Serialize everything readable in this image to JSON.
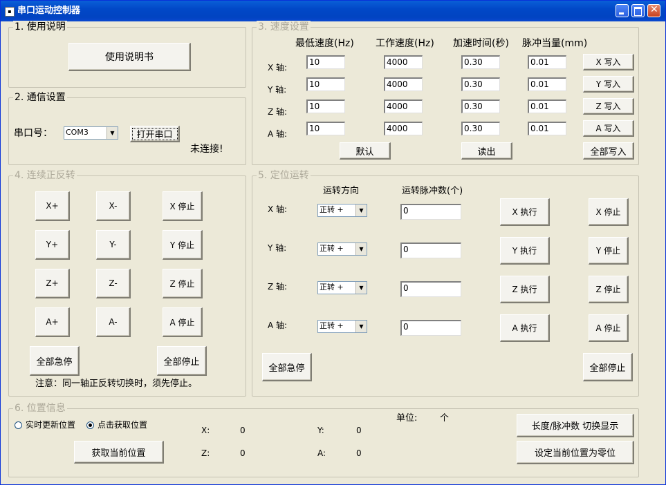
{
  "window": {
    "title": "串口运动控制器",
    "app_icon": "app-icon"
  },
  "usage": {
    "group": "1. 使用说明",
    "manual_button": "使用说明书"
  },
  "comm": {
    "group": "2. 通信设置",
    "port_label": "串口号：",
    "port_value": "COM3",
    "open_button": "打开串口",
    "status": "未连接!"
  },
  "speed": {
    "group": "3. 速度设置",
    "headers": {
      "min_speed": "最低速度(Hz)",
      "work_speed": "工作速度(Hz)",
      "accel_time": "加速时间(秒)",
      "pulse_eq": "脉冲当量(mm)"
    },
    "rows": [
      {
        "axis": "X 轴:",
        "min": "10",
        "work": "4000",
        "accel": "0.30",
        "pulse": "0.01",
        "write": "X 写入"
      },
      {
        "axis": "Y 轴:",
        "min": "10",
        "work": "4000",
        "accel": "0.30",
        "pulse": "0.01",
        "write": "Y 写入"
      },
      {
        "axis": "Z 轴:",
        "min": "10",
        "work": "4000",
        "accel": "0.30",
        "pulse": "0.01",
        "write": "Z 写入"
      },
      {
        "axis": "A 轴:",
        "min": "10",
        "work": "4000",
        "accel": "0.30",
        "pulse": "0.01",
        "write": "A 写入"
      }
    ],
    "default_button": "默认",
    "read_button": "读出",
    "write_all_button": "全部写入"
  },
  "continuous": {
    "group": "4. 连续正反转",
    "rows": [
      {
        "plus": "X+",
        "minus": "X-",
        "stop": "X 停止"
      },
      {
        "plus": "Y+",
        "minus": "Y-",
        "stop": "Y 停止"
      },
      {
        "plus": "Z+",
        "minus": "Z-",
        "stop": "Z 停止"
      },
      {
        "plus": "A+",
        "minus": "A-",
        "stop": "A 停止"
      }
    ],
    "estop_all": "全部急停",
    "stop_all": "全部停止",
    "note": "注意：同一轴正反转切换时，须先停止。"
  },
  "positioning": {
    "group": "5. 定位运转",
    "dir_header": "运转方向",
    "pulse_header": "运转脉冲数(个)",
    "rows": [
      {
        "axis": "X 轴:",
        "dir": "正转 +",
        "pulses": "0",
        "exec": "X 执行",
        "stop": "X 停止"
      },
      {
        "axis": "Y 轴:",
        "dir": "正转 +",
        "pulses": "0",
        "exec": "Y 执行",
        "stop": "Y 停止"
      },
      {
        "axis": "Z 轴:",
        "dir": "正转 +",
        "pulses": "0",
        "exec": "Z 执行",
        "stop": "Z 停止"
      },
      {
        "axis": "A 轴:",
        "dir": "正转 +",
        "pulses": "0",
        "exec": "A 执行",
        "stop": "A 停止"
      }
    ],
    "estop_all": "全部急停",
    "stop_all": "全部停止"
  },
  "position": {
    "group": "6. 位置信息",
    "radio_realtime": "实时更新位置",
    "radio_click": "点击获取位置",
    "selected_mode": "click",
    "get_button": "获取当前位置",
    "unit_label": "单位:",
    "unit_value": "个",
    "x_label": "X:",
    "x_value": "0",
    "y_label": "Y:",
    "y_value": "0",
    "z_label": "Z:",
    "z_value": "0",
    "a_label": "A:",
    "a_value": "0",
    "toggle_button": "长度/脉冲数  切换显示",
    "zero_button": "设定当前位置为零位"
  }
}
